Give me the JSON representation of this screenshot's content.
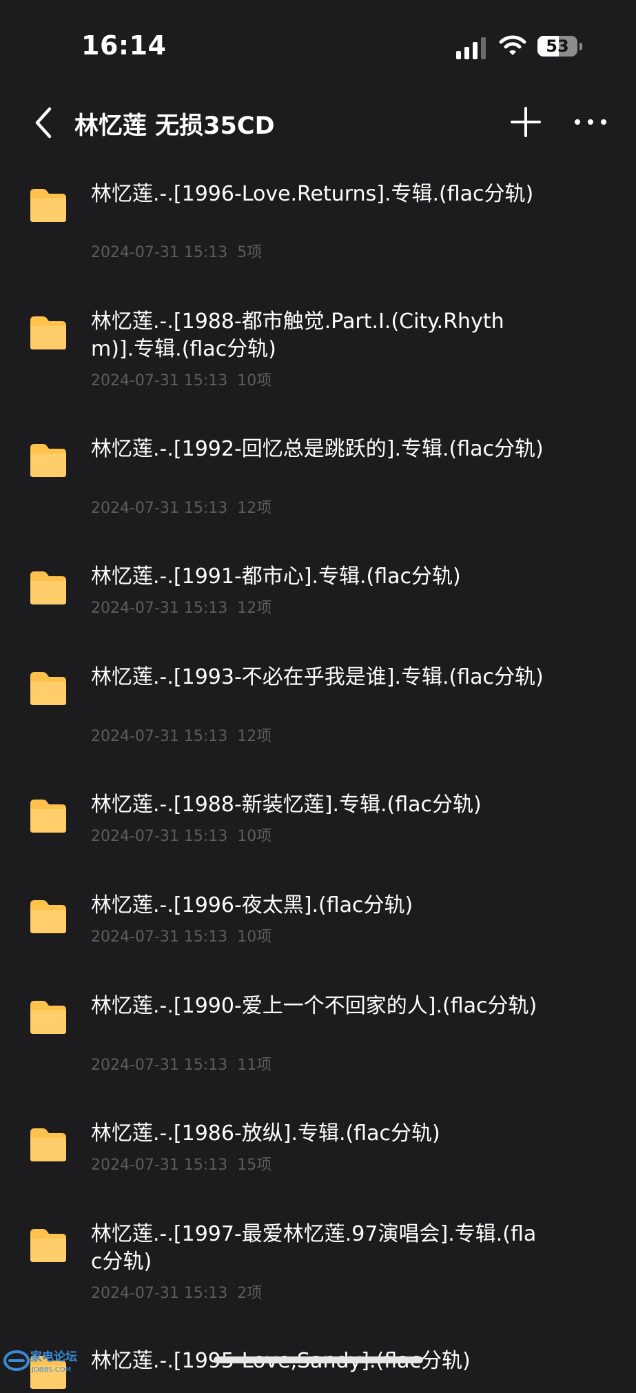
{
  "status_bar": {
    "time": "16:14",
    "battery_level": "53",
    "battery_fraction": 0.53,
    "signal_icon": "cellular-signal-icon",
    "wifi_icon": "wifi-icon"
  },
  "nav": {
    "title": "林忆莲 无损35CD",
    "back_icon": "chevron-left-icon",
    "add_icon": "plus-icon",
    "more_icon": "ellipsis-icon"
  },
  "colors": {
    "background": "#1c1c1e",
    "folder": "#ffc24d",
    "meta_text": "#5d5d60",
    "text": "#ffffff"
  },
  "folders": [
    {
      "name": "林忆莲.-.[1996-Love.Returns].专辑.(flac分轨)",
      "date": "2024-07-31 15:13",
      "count": "5项"
    },
    {
      "name": "林忆莲.-.[1988-都市触觉.Part.I.(City.Rhythm)].专辑.(flac分轨)",
      "date": "2024-07-31 15:13",
      "count": "10项"
    },
    {
      "name": "林忆莲.-.[1992-回忆总是跳跃的].专辑.(flac分轨)",
      "date": "2024-07-31 15:13",
      "count": "12项"
    },
    {
      "name": "林忆莲.-.[1991-都市心].专辑.(flac分轨)",
      "date": "2024-07-31 15:13",
      "count": "12项"
    },
    {
      "name": "林忆莲.-.[1993-不必在乎我是谁].专辑.(flac分轨)",
      "date": "2024-07-31 15:13",
      "count": "12项"
    },
    {
      "name": "林忆莲.-.[1988-新装忆莲].专辑.(flac分轨)",
      "date": "2024-07-31 15:13",
      "count": "10项"
    },
    {
      "name": "林忆莲.-.[1996-夜太黑].(flac分轨)",
      "date": "2024-07-31 15:13",
      "count": "10项"
    },
    {
      "name": "林忆莲.-.[1990-爱上一个不回家的人].(flac分轨)",
      "date": "2024-07-31 15:13",
      "count": "11项"
    },
    {
      "name": "林忆莲.-.[1986-放纵].专辑.(flac分轨)",
      "date": "2024-07-31 15:13",
      "count": "15项"
    },
    {
      "name": "林忆莲.-.[1997-最爱林忆莲.97演唱会].专辑.(flac分轨)",
      "date": "2024-07-31 15:13",
      "count": "2项"
    },
    {
      "name": "林忆莲.-.[1995-Love,Sandy].(flac分轨)",
      "date": "",
      "count": ""
    }
  ],
  "watermark": {
    "text": "家电论坛",
    "subtext": "JDBBS.COM"
  }
}
